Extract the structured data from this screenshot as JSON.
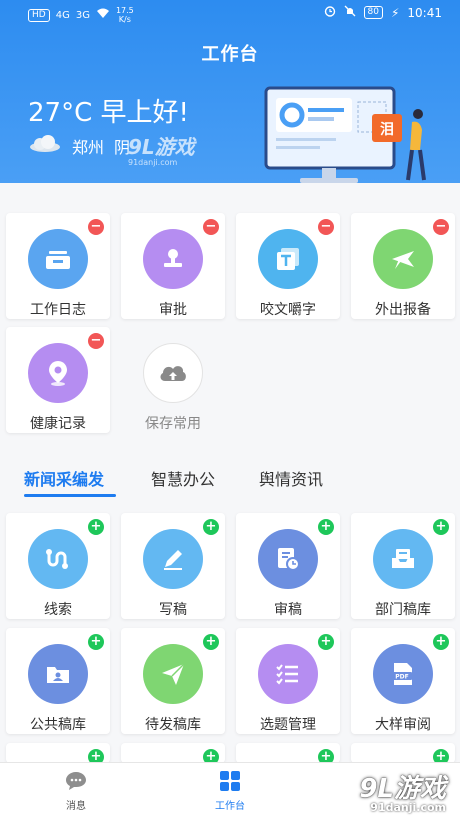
{
  "status_bar": {
    "left_badge": "HD",
    "signal1": "4G",
    "signal2": "3G",
    "speed_value": "17.5",
    "speed_unit": "K/s",
    "battery": "80",
    "time": "10:41"
  },
  "header": {
    "title": "工作台",
    "greeting": "27°C 早上好!",
    "city": "郑州",
    "weather": "阴"
  },
  "watermark": {
    "brand": "9L游戏",
    "domain": "91danji.com"
  },
  "illustration": {
    "doc_icon_text": "泪"
  },
  "quick_tiles": [
    {
      "label": "工作日志",
      "color": "#5aa5f0",
      "icon": "inbox-icon",
      "badge": "−"
    },
    {
      "label": "审批",
      "color": "#b58df1",
      "icon": "stamp-icon",
      "badge": "−"
    },
    {
      "label": "咬文嚼字",
      "color": "#4fb4ef",
      "icon": "text-icon",
      "badge": "−"
    },
    {
      "label": "外出报备",
      "color": "#7fd672",
      "icon": "plane-icon",
      "badge": "−"
    },
    {
      "label": "健康记录",
      "color": "#b58df1",
      "icon": "location-icon",
      "badge": "−"
    },
    {
      "label": "保存常用",
      "color": "#ffffff",
      "icon": "cloud-upload-icon",
      "badge": ""
    }
  ],
  "tabs": [
    {
      "label": "新闻采编发",
      "active": true
    },
    {
      "label": "智慧办公",
      "active": false
    },
    {
      "label": "舆情资讯",
      "active": false
    }
  ],
  "tab_tiles": [
    {
      "label": "线索",
      "color": "#63b8f2",
      "icon": "route-icon",
      "badge": "+"
    },
    {
      "label": "写稿",
      "color": "#63b8f2",
      "icon": "pencil-icon",
      "badge": "+"
    },
    {
      "label": "审稿",
      "color": "#6c8fe0",
      "icon": "doc-clock-icon",
      "badge": "+"
    },
    {
      "label": "部门稿库",
      "color": "#63b8f2",
      "icon": "tray-icon",
      "badge": "+"
    },
    {
      "label": "公共稿库",
      "color": "#6c8fe0",
      "icon": "folder-icon",
      "badge": "+"
    },
    {
      "label": "待发稿库",
      "color": "#7fd672",
      "icon": "send-icon",
      "badge": "+"
    },
    {
      "label": "选题管理",
      "color": "#b58df1",
      "icon": "checklist-icon",
      "badge": "+"
    },
    {
      "label": "大样审阅",
      "color": "#6c8fe0",
      "icon": "pdf-icon",
      "badge": "+"
    }
  ],
  "bottom_nav": [
    {
      "label": "消息",
      "active": false
    },
    {
      "label": "工作台",
      "active": true
    }
  ]
}
